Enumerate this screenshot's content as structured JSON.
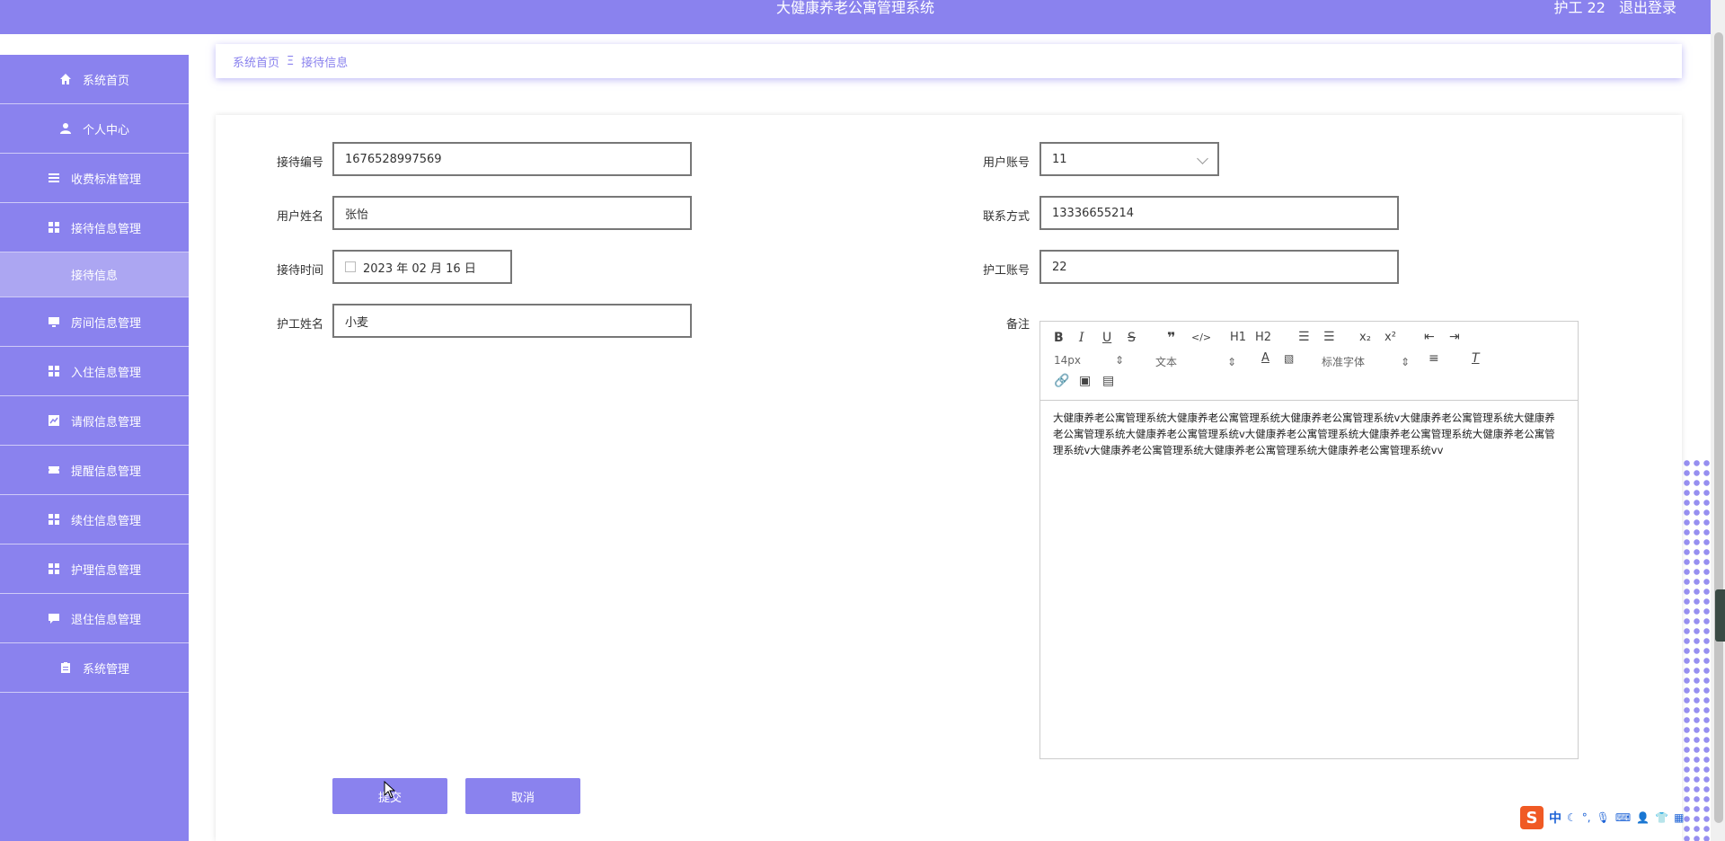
{
  "header": {
    "title": "大健康养老公寓管理系统",
    "user": "护工 22",
    "logout": "退出登录"
  },
  "sidebar": {
    "items": [
      {
        "label": "系统首页",
        "icon": "home-icon"
      },
      {
        "label": "个人中心",
        "icon": "user-icon"
      },
      {
        "label": "收费标准管理",
        "icon": "list-icon"
      },
      {
        "label": "接待信息管理",
        "icon": "grid-icon"
      },
      {
        "label": "接待信息",
        "icon": ""
      },
      {
        "label": "房间信息管理",
        "icon": "monitor-icon"
      },
      {
        "label": "入住信息管理",
        "icon": "grid-icon"
      },
      {
        "label": "请假信息管理",
        "icon": "chart-icon"
      },
      {
        "label": "提醒信息管理",
        "icon": "ticket-icon"
      },
      {
        "label": "续住信息管理",
        "icon": "grid-icon"
      },
      {
        "label": "护理信息管理",
        "icon": "grid-icon"
      },
      {
        "label": "退住信息管理",
        "icon": "chat-icon"
      },
      {
        "label": "系统管理",
        "icon": "clipboard-icon"
      }
    ]
  },
  "breadcrumb": {
    "home": "系统首页",
    "separator": "Ξ",
    "current": "接待信息"
  },
  "form": {
    "reception_no": {
      "label": "接待编号",
      "value": "1676528997569"
    },
    "user_account": {
      "label": "用户账号",
      "value": "11"
    },
    "user_name": {
      "label": "用户姓名",
      "value": "张怡"
    },
    "contact": {
      "label": "联系方式",
      "value": "13336655214"
    },
    "reception_time": {
      "label": "接待时间",
      "value": "2023 年 02 月 16 日"
    },
    "nurse_account": {
      "label": "护工账号",
      "value": "22"
    },
    "nurse_name": {
      "label": "护工姓名",
      "value": "小麦"
    },
    "remark": {
      "label": "备注"
    }
  },
  "editor": {
    "font_size": "14px",
    "block_type": "文本",
    "font_family": "标准字体",
    "h1": "H1",
    "h2": "H2",
    "content": "大健康养老公寓管理系统大健康养老公寓管理系统大健康养老公寓管理系统v大健康养老公寓管理系统大健康养老公寓管理系统大健康养老公寓管理系统v大健康养老公寓管理系统大健康养老公寓管理系统大健康养老公寓管理系统v大健康养老公寓管理系统大健康养老公寓管理系统大健康养老公寓管理系统vv"
  },
  "actions": {
    "submit": "提交",
    "cancel": "取消"
  },
  "ime": {
    "logo": "S",
    "mode": "中"
  },
  "colors": {
    "accent": "#8a82ee",
    "submenu_active": "#aca6f2"
  }
}
